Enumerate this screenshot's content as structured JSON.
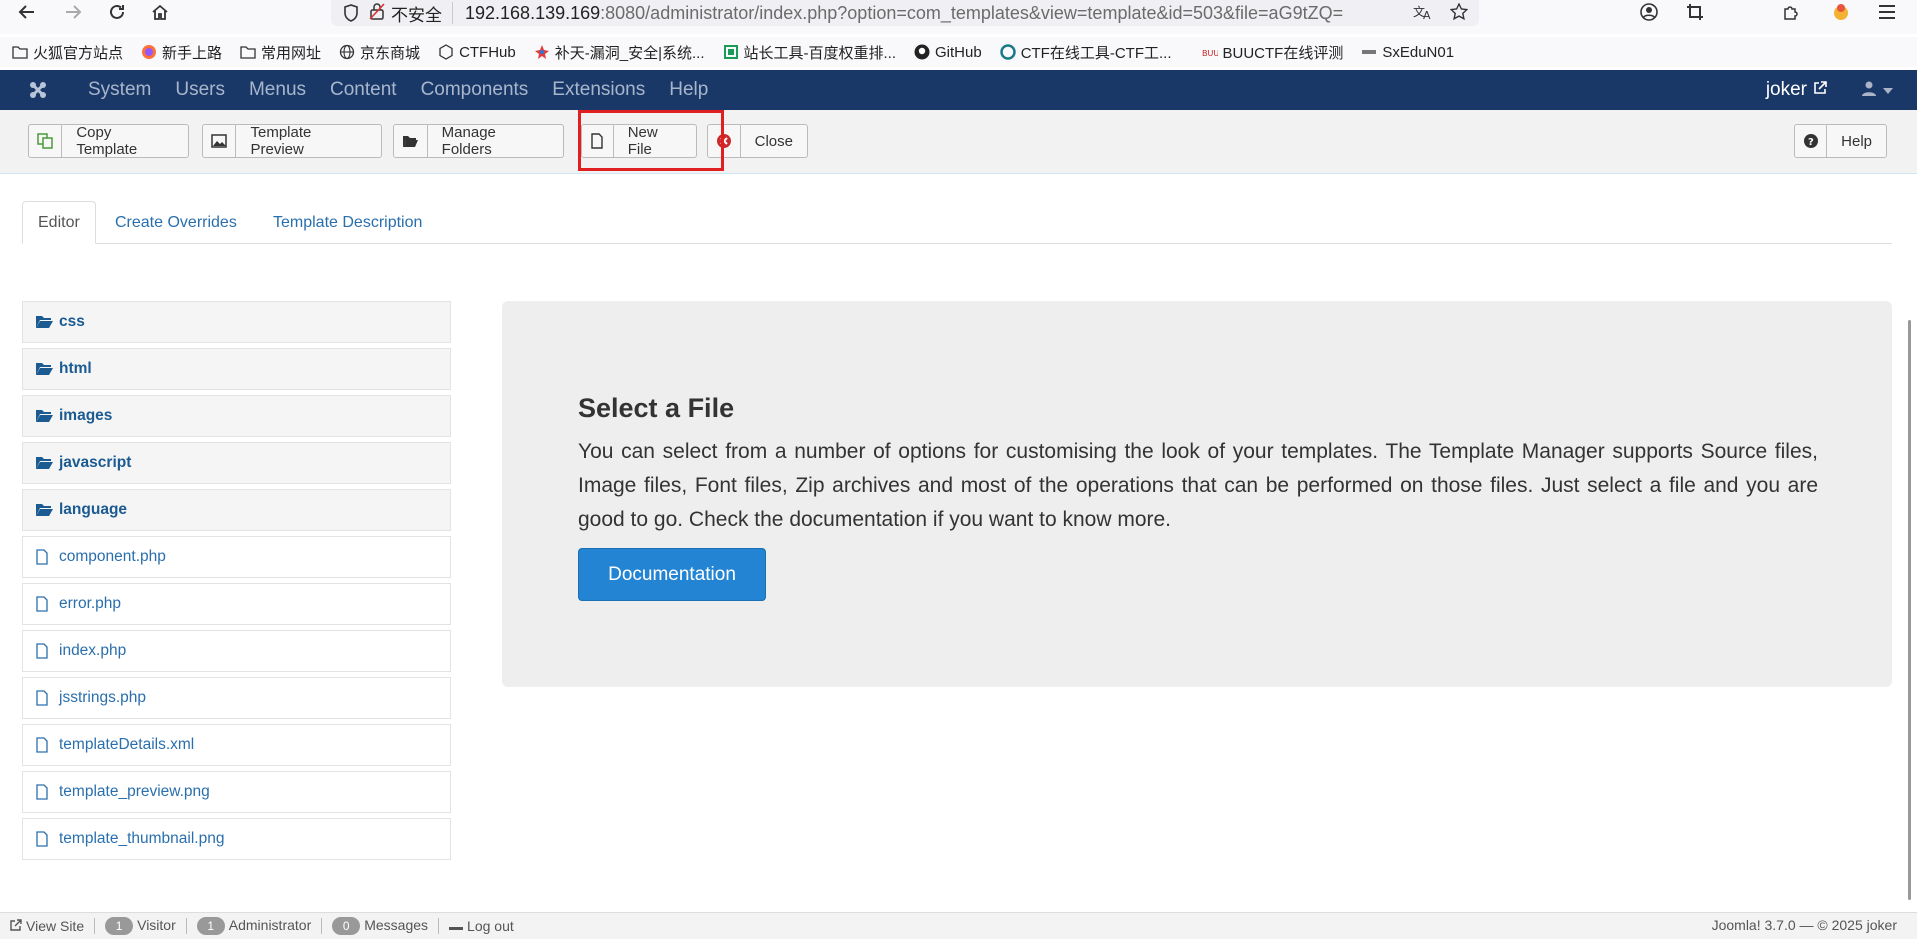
{
  "browser": {
    "insecure_label": "不安全",
    "url_host": "192.168.139.169",
    "url_rest": ":8080/administrator/index.php?option=com_templates&view=template&id=503&file=aG9tZQ=",
    "bookmarks": [
      {
        "label": "火狐官方站点",
        "icon": "folder-icon"
      },
      {
        "label": "新手上路",
        "icon": "firefox-icon"
      },
      {
        "label": "常用网址",
        "icon": "folder-icon"
      },
      {
        "label": "京东商城",
        "icon": "globe-icon"
      },
      {
        "label": "CTFHub",
        "icon": "ctfhub-icon"
      },
      {
        "label": "补天-漏洞_安全|系统...",
        "icon": "butian-icon"
      },
      {
        "label": "站长工具-百度权重排...",
        "icon": "chinaz-icon"
      },
      {
        "label": "GitHub",
        "icon": "github-icon"
      },
      {
        "label": "CTF在线工具-CTF工...",
        "icon": "ctftools-icon"
      },
      {
        "label": "BUUCTF在线评测",
        "icon": "buuctf-icon"
      },
      {
        "label": "SxEduN01",
        "icon": "sxedu-icon"
      }
    ]
  },
  "joomla": {
    "menu": [
      "System",
      "Users",
      "Menus",
      "Content",
      "Components",
      "Extensions",
      "Help"
    ],
    "user": "joker"
  },
  "toolbar": {
    "copy_template": "Copy Template",
    "template_preview": "Template Preview",
    "manage_folders": "Manage Folders",
    "new_file": "New File",
    "close": "Close",
    "help": "Help"
  },
  "tabs": [
    "Editor",
    "Create Overrides",
    "Template Description"
  ],
  "files": {
    "folders": [
      "css",
      "html",
      "images",
      "javascript",
      "language"
    ],
    "files": [
      "component.php",
      "error.php",
      "index.php",
      "jsstrings.php",
      "templateDetails.xml",
      "template_preview.png",
      "template_thumbnail.png"
    ]
  },
  "panel": {
    "title": "Select a File",
    "body": "You can select from a number of options for customising the look of your templates. The Template Manager supports Source files, Image files, Font files, Zip archives and most of the operations that can be performed on those files. Just select a file and you are good to go. Check the documentation if you want to know more.",
    "button": "Documentation"
  },
  "footer": {
    "view_site": "View Site",
    "visitor_count": "1",
    "visitor_label": "Visitor",
    "admin_count": "1",
    "admin_label": "Administrator",
    "messages_count": "0",
    "messages_label": "Messages",
    "logout": "Log out",
    "version": "Joomla! 3.7.0 — © 2025 joker"
  },
  "colors": {
    "joomla_nav": "#1a3867",
    "link": "#2a6fad",
    "primary_button": "#2384d3",
    "highlight": "#e02020"
  }
}
